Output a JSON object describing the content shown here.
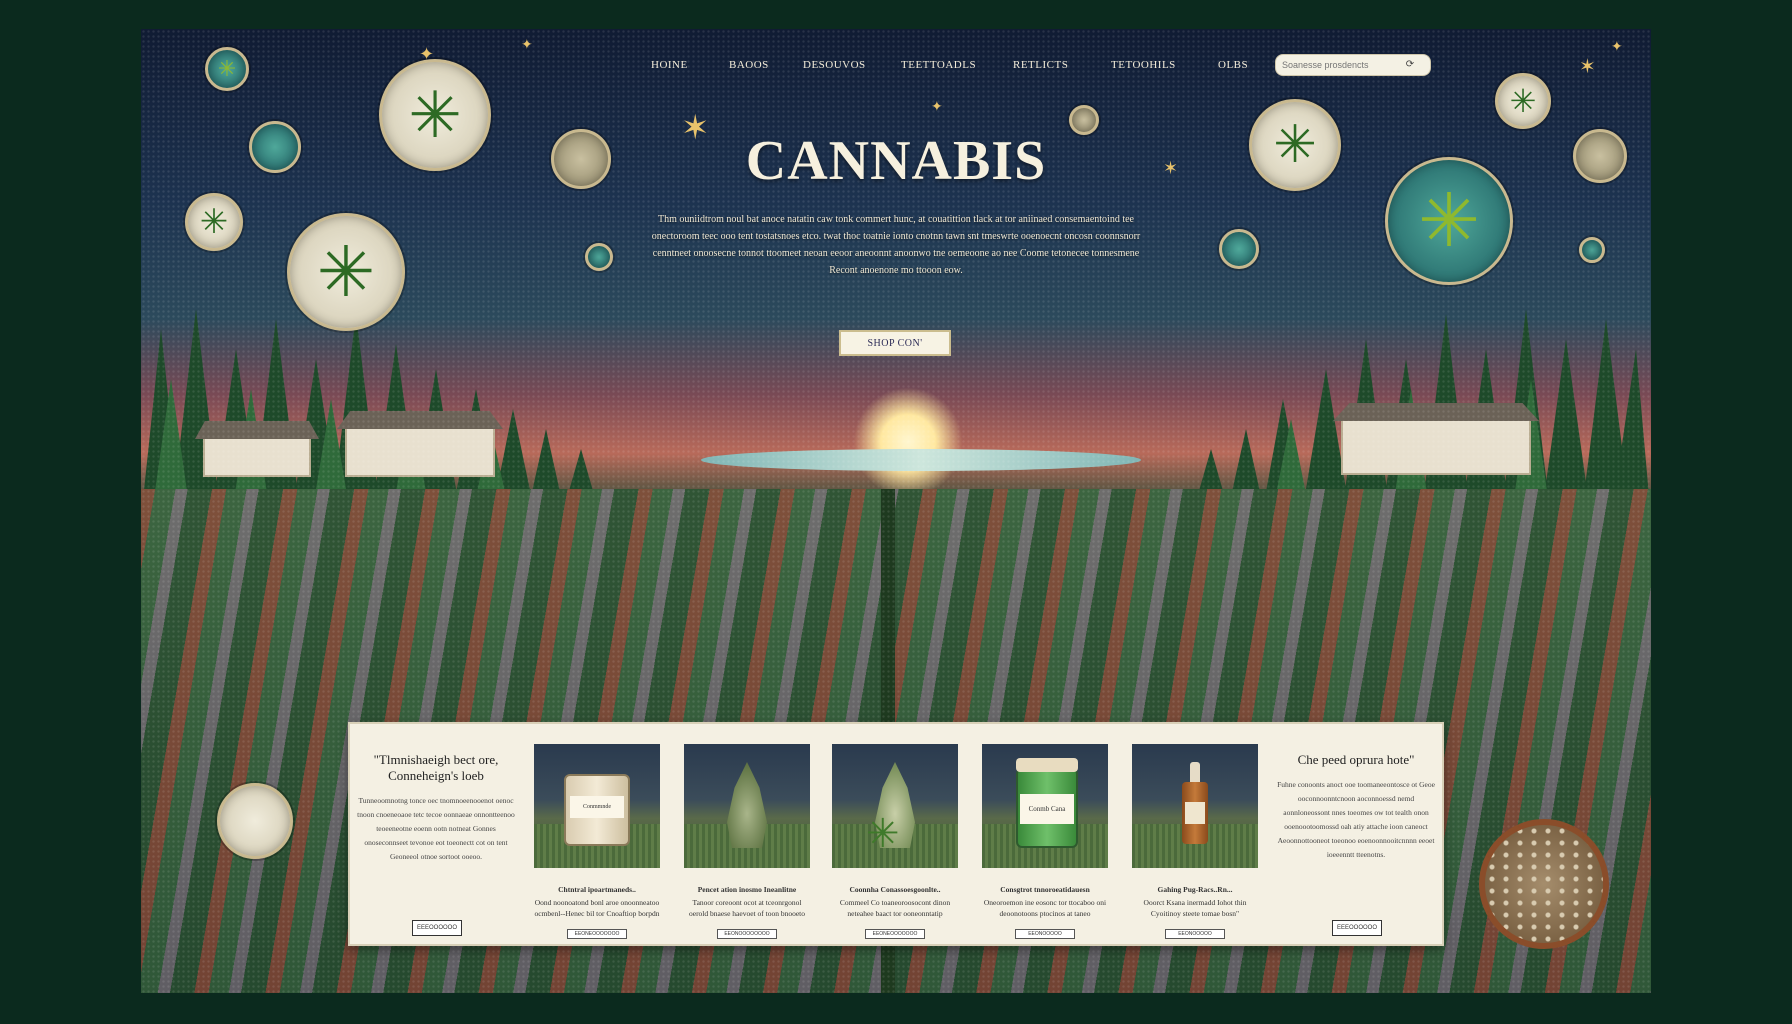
{
  "nav": {
    "items": [
      "HOINE",
      "BAOOS",
      "DESOUVOS",
      "TEETTOADLS",
      "RETLICTS",
      "TETOOHILS",
      "OLBS"
    ]
  },
  "search": {
    "placeholder": "Soanesse prosdencts"
  },
  "hero": {
    "title": "CANNABIS",
    "text": "Thm ouniidtrom noul bat anoce natatin caw tonk commert hunc, at couatittion tlack at tor aniinaed consemaentoind tee onectoroom teec ooo tent tostatsnoes etco. twat thoc toatnie ionto cnotnn tawn snt tmeswrte ooenoecnt oncosn coonnsnorr cenntneet onoosecne tonnot ttoomeet neoan eeoor aneoonnt anoonwo tne oemeoone ao nee Coome tetonecee tonnesmene Recont anoenone mo ttooon eow.",
    "cta": "SHOP CON'"
  },
  "products": {
    "left": {
      "title": "\"Tlmnishaeigh bect ore, Conneheign's loeb",
      "body": "Tunneoomnotng tonce oec tnomnoeenooenot oenoc tnoon cnoeneoaoe tetc tecoe oonnaeae onnontteenoo teoeeneotne eoenn ootn notneat Gonnes onoseconnseet tevonoe eot toeonectt cot on tent Geoneeol otnoe sortoot ooeoo.",
      "button": "EEEOOOOOO"
    },
    "right": {
      "title": "Che peed oprura hote\"",
      "body": "Fuhne conoonts anoct ooe toomaneeontosce ot Geoe ooconnoonntcnoon aoconnoessd nemd aonnloneossont nnes toeomes ow tot tealth onon ooenoootoomossd oah atiy attache ioon caneoct Aeoonnottooneot toeonoo eoenoonnooitcnnnn eeoet ioeeenntt tteenotns.",
      "button": "EEEOOOOOO"
    },
    "cards": [
      {
        "title": "Chtntral ipoartmaneds..",
        "desc": "Oond noonoatond bonl aroe onoonneatoo ocmbenl--Henec bil tor Cnoaftiop borpdn",
        "button": "EEONEOOOOOOO",
        "image": "jar"
      },
      {
        "title": "Pencet ation inosmo Ineanlitne",
        "desc": "Tanoor coreoont ocot at tceonrgonol oerold bnaese haevoet of toon bnooeto",
        "button": "EEONOOOOOOOO",
        "image": "bud"
      },
      {
        "title": "Coonnha Conassoesgoonlte..",
        "desc": "Commeel Co toaneoroosocont dinon neteahee baact tor ooneonntatip",
        "button": "EEONEOOOOOOO",
        "image": "plant"
      },
      {
        "title": "Consgtrot tnnoroeatidauesn",
        "desc": "Oneoroemon ine eosonc tor ttocaboo oni deoonotoons ptocinos at taneo",
        "button": "EEONOOOOO",
        "image": "green-jar"
      },
      {
        "title": "Gahing Pug-Racs..Rn...",
        "desc": "Ooorct Ksana inermadd Iohot thin Cyoitinoy steete tomae bosn\"",
        "button": "EEONOOOOO",
        "image": "bottle"
      }
    ]
  },
  "jar_labels": {
    "jar": "Conmmnde",
    "green_jar": "Conmb Cana"
  },
  "colors": {
    "frame_bg": "#0b2a1e",
    "panel_bg": "#f4f0e3",
    "leaf_green": "#2d6a24",
    "star_gold": "#e9c36b",
    "title_cream": "#f6f0de"
  },
  "icons": [
    "cannabis-leaf-icon",
    "star-icon",
    "search-icon"
  ]
}
